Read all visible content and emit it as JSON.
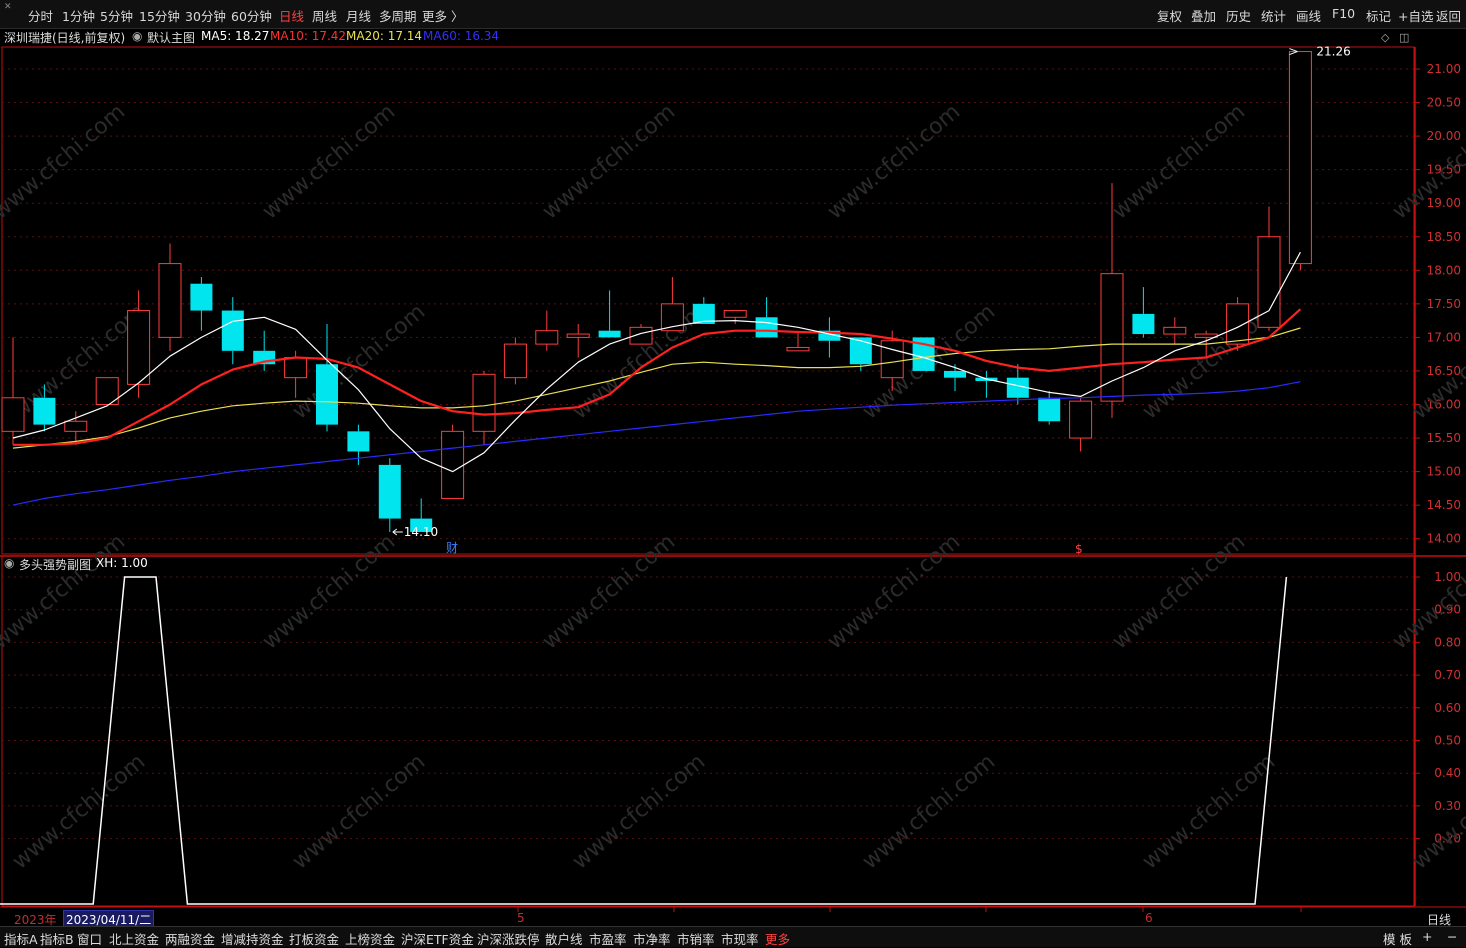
{
  "toolbar": {
    "periods": [
      "分时",
      "1分钟",
      "5分钟",
      "15分钟",
      "30分钟",
      "60分钟",
      "日线",
      "周线",
      "月线",
      "多周期",
      "更多 〉"
    ],
    "active_period": "日线",
    "tools": [
      "复权",
      "叠加",
      "历史",
      "统计",
      "画线",
      "F10",
      "标记",
      "+自选",
      "返回"
    ]
  },
  "main_info": {
    "stock": "深圳瑞捷(日线,前复权)",
    "template": "默认主图",
    "ma5": "MA5: 18.27",
    "ma10": "MA10: 17.42",
    "ma20": "MA20: 17.14",
    "ma60": "MA60: 16.34"
  },
  "colors": {
    "up": "#ff3c3c",
    "down": "#00e5ee",
    "ma5": "#ffffff",
    "ma10": "#ff2020",
    "ma20": "#e8e050",
    "ma60": "#2a2aff",
    "axis": "#c01010",
    "grid": "#5a1010"
  },
  "price_axis": {
    "min": 14.0,
    "max": 21.0,
    "ticks": [
      "21.00",
      "20.50",
      "20.00",
      "19.50",
      "19.00",
      "18.50",
      "18.00",
      "17.50",
      "17.00",
      "16.50",
      "16.00",
      "15.50",
      "15.00",
      "14.50",
      "14.00"
    ]
  },
  "markers": {
    "high_label": "21.26",
    "low_label": "14.10",
    "fin_marker": "财",
    "dollar_marker": "$"
  },
  "chart_data": [
    {
      "type": "candlestick",
      "title": "深圳瑞捷(日线,前复权)",
      "candles": [
        {
          "o": 15.6,
          "h": 17.0,
          "l": 15.4,
          "c": 16.1
        },
        {
          "o": 16.1,
          "h": 16.3,
          "l": 15.6,
          "c": 15.7
        },
        {
          "o": 15.6,
          "h": 15.9,
          "l": 15.4,
          "c": 15.75
        },
        {
          "o": 16.0,
          "h": 16.4,
          "l": 16.0,
          "c": 16.4
        },
        {
          "o": 16.3,
          "h": 17.7,
          "l": 16.1,
          "c": 17.4
        },
        {
          "o": 17.0,
          "h": 18.4,
          "l": 16.8,
          "c": 18.1
        },
        {
          "o": 17.8,
          "h": 17.9,
          "l": 17.1,
          "c": 17.4
        },
        {
          "o": 17.4,
          "h": 17.6,
          "l": 16.6,
          "c": 16.8
        },
        {
          "o": 16.8,
          "h": 17.1,
          "l": 16.5,
          "c": 16.6
        },
        {
          "o": 16.4,
          "h": 16.8,
          "l": 16.1,
          "c": 16.7
        },
        {
          "o": 16.6,
          "h": 17.2,
          "l": 15.6,
          "c": 15.7
        },
        {
          "o": 15.6,
          "h": 15.7,
          "l": 15.1,
          "c": 15.3
        },
        {
          "o": 15.1,
          "h": 15.2,
          "l": 14.1,
          "c": 14.3
        },
        {
          "o": 14.3,
          "h": 14.6,
          "l": 14.1,
          "c": 14.1
        },
        {
          "o": 14.6,
          "h": 15.7,
          "l": 14.6,
          "c": 15.6
        },
        {
          "o": 15.6,
          "h": 16.5,
          "l": 15.4,
          "c": 16.45
        },
        {
          "o": 16.4,
          "h": 17.0,
          "l": 16.3,
          "c": 16.9
        },
        {
          "o": 16.9,
          "h": 17.4,
          "l": 16.8,
          "c": 17.1
        },
        {
          "o": 17.0,
          "h": 17.2,
          "l": 16.7,
          "c": 17.05
        },
        {
          "o": 17.1,
          "h": 17.7,
          "l": 17.0,
          "c": 17.0
        },
        {
          "o": 16.9,
          "h": 17.2,
          "l": 16.9,
          "c": 17.15
        },
        {
          "o": 17.1,
          "h": 17.9,
          "l": 17.1,
          "c": 17.5
        },
        {
          "o": 17.5,
          "h": 17.6,
          "l": 17.2,
          "c": 17.2
        },
        {
          "o": 17.3,
          "h": 17.4,
          "l": 17.2,
          "c": 17.4
        },
        {
          "o": 17.3,
          "h": 17.6,
          "l": 17.0,
          "c": 17.0
        },
        {
          "o": 16.8,
          "h": 17.1,
          "l": 16.8,
          "c": 16.85
        },
        {
          "o": 17.1,
          "h": 17.3,
          "l": 16.7,
          "c": 16.95
        },
        {
          "o": 17.0,
          "h": 17.0,
          "l": 16.5,
          "c": 16.6
        },
        {
          "o": 16.4,
          "h": 17.1,
          "l": 16.2,
          "c": 16.95
        },
        {
          "o": 17.0,
          "h": 17.0,
          "l": 16.5,
          "c": 16.5
        },
        {
          "o": 16.5,
          "h": 16.6,
          "l": 16.2,
          "c": 16.4
        },
        {
          "o": 16.4,
          "h": 16.5,
          "l": 16.1,
          "c": 16.35
        },
        {
          "o": 16.4,
          "h": 16.6,
          "l": 16.0,
          "c": 16.1
        },
        {
          "o": 16.1,
          "h": 16.2,
          "l": 15.7,
          "c": 15.75
        },
        {
          "o": 15.5,
          "h": 16.1,
          "l": 15.3,
          "c": 16.05
        },
        {
          "o": 16.05,
          "h": 19.3,
          "l": 15.8,
          "c": 17.95
        },
        {
          "o": 17.35,
          "h": 17.75,
          "l": 17.0,
          "c": 17.05
        },
        {
          "o": 17.05,
          "h": 17.3,
          "l": 16.9,
          "c": 17.15
        },
        {
          "o": 17.0,
          "h": 17.1,
          "l": 16.7,
          "c": 17.05
        },
        {
          "o": 16.9,
          "h": 17.6,
          "l": 16.8,
          "c": 17.5
        },
        {
          "o": 17.15,
          "h": 18.95,
          "l": 17.1,
          "c": 18.5
        },
        {
          "o": 18.1,
          "h": 21.26,
          "l": 18.0,
          "c": 21.26
        }
      ],
      "ma5": [
        15.5,
        15.62,
        15.8,
        15.98,
        16.32,
        16.72,
        17.0,
        17.24,
        17.3,
        17.12,
        16.66,
        16.22,
        15.64,
        15.2,
        15.0,
        15.28,
        15.77,
        16.23,
        16.63,
        16.9,
        17.06,
        17.16,
        17.24,
        17.25,
        17.22,
        17.15,
        17.05,
        16.95,
        16.82,
        16.7,
        16.55,
        16.38,
        16.28,
        16.18,
        16.12,
        16.35,
        16.55,
        16.8,
        16.95,
        17.15,
        17.4,
        18.27
      ],
      "ma10": [
        15.4,
        15.4,
        15.42,
        15.5,
        15.75,
        16.0,
        16.3,
        16.52,
        16.64,
        16.7,
        16.68,
        16.55,
        16.3,
        16.05,
        15.9,
        15.85,
        15.87,
        15.92,
        15.96,
        16.15,
        16.55,
        16.85,
        17.05,
        17.1,
        17.1,
        17.08,
        17.07,
        17.05,
        16.98,
        16.9,
        16.8,
        16.65,
        16.55,
        16.5,
        16.55,
        16.6,
        16.63,
        16.67,
        16.7,
        16.85,
        17.0,
        17.42
      ],
      "ma20": [
        15.35,
        15.4,
        15.45,
        15.52,
        15.65,
        15.8,
        15.9,
        15.98,
        16.02,
        16.05,
        16.04,
        16.02,
        15.98,
        15.95,
        15.95,
        15.98,
        16.05,
        16.15,
        16.25,
        16.35,
        16.48,
        16.6,
        16.63,
        16.6,
        16.58,
        16.55,
        16.55,
        16.57,
        16.63,
        16.7,
        16.76,
        16.8,
        16.82,
        16.83,
        16.87,
        16.9,
        16.9,
        16.9,
        16.9,
        16.95,
        17.0,
        17.14
      ],
      "ma60": [
        14.5,
        14.6,
        14.67,
        14.73,
        14.8,
        14.87,
        14.93,
        15.0,
        15.05,
        15.1,
        15.15,
        15.2,
        15.25,
        15.3,
        15.35,
        15.4,
        15.45,
        15.5,
        15.55,
        15.6,
        15.65,
        15.7,
        15.75,
        15.8,
        15.85,
        15.9,
        15.93,
        15.96,
        15.99,
        16.01,
        16.03,
        16.05,
        16.07,
        16.09,
        16.1,
        16.12,
        16.14,
        16.15,
        16.17,
        16.2,
        16.25,
        16.34
      ]
    },
    {
      "type": "line",
      "title": "多头强势副图",
      "series": [
        {
          "name": "XH",
          "values": [
            0,
            0,
            0,
            0,
            1,
            1,
            0,
            0,
            0,
            0,
            0,
            0,
            0,
            0,
            0,
            0,
            0,
            0,
            0,
            0,
            0,
            0,
            0,
            0,
            0,
            0,
            0,
            0,
            0,
            0,
            0,
            0,
            0,
            0,
            0,
            0,
            0,
            0,
            0,
            0,
            0,
            1
          ]
        }
      ],
      "ylim": [
        0,
        1
      ],
      "ticks": [
        "1.00",
        "0.90",
        "0.80",
        "0.70",
        "0.60",
        "0.50",
        "0.40",
        "0.30",
        "0.20"
      ]
    }
  ],
  "sub_info": {
    "name": "多头强势副图",
    "value": "XH: 1.00"
  },
  "date_bar": {
    "year": "2023年",
    "cursor_date": "2023/04/11/二",
    "month5": "5",
    "month6": "6",
    "period_label": "日线"
  },
  "bottom_tabs": [
    "指标A",
    "指标B",
    "窗口",
    "北上资金",
    "两融资金",
    "增减持资金",
    "打板资金",
    "上榜资金",
    "沪深ETF资金",
    "沪深涨跌停",
    "散户线",
    "市盈率",
    "市净率",
    "市销率",
    "市现率",
    "更多"
  ],
  "bottom_right": [
    "模 板",
    "+",
    "−"
  ],
  "watermark": "www.cfchi.com"
}
